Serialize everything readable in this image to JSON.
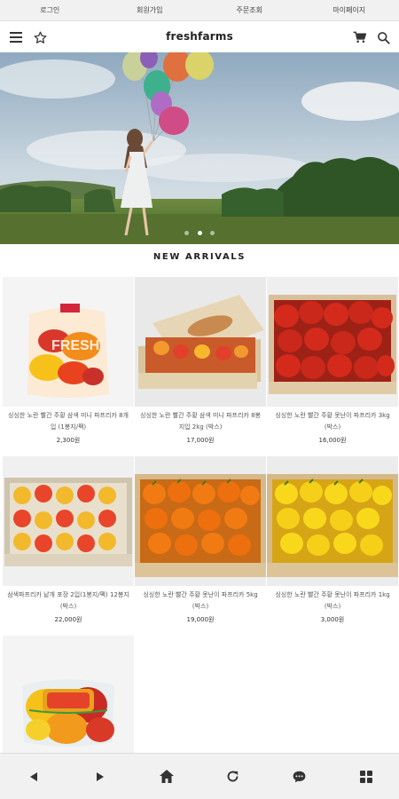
{
  "top_nav": {
    "login": "로그인",
    "signup": "회원가입",
    "order_lookup": "주문조회",
    "mypage": "마이페이지"
  },
  "header": {
    "logo": "freshfarms",
    "menu_icon": "menu-icon",
    "star_icon": "star-icon",
    "cart_icon": "cart-icon",
    "search_icon": "search-icon"
  },
  "hero": {
    "slide_count": 3,
    "active_slide": 2
  },
  "section": {
    "title": "NEW ARRIVALS"
  },
  "products": [
    {
      "name": "싱싱한 노란 빨간 주황 삼색 미니 파프리카 8개입 (1봉지/팩)",
      "price": "2,300원"
    },
    {
      "name": "싱싱한 노란 빨간 주황 삼색 미니 파프리카 8봉지입 2kg (박스)",
      "price": "17,000원"
    },
    {
      "name": "싱싱한 노란 빨간 주황 못난이 파프리카 3kg (박스)",
      "price": "16,000원"
    },
    {
      "name": "삼색파프리카 낱개 포장 2입(1봉지/팩) 12봉지 (박스)",
      "price": "22,000원"
    },
    {
      "name": "싱싱한 노란 빨간 주황 못난이 파프리카 5kg (박스)",
      "price": "19,000원"
    },
    {
      "name": "싱싱한 노란 빨간 주황 못난이 파프리카 1kg (박스)",
      "price": "3,000원"
    },
    {
      "name": "",
      "price": ""
    }
  ],
  "bottom_bar": [
    "back-icon",
    "forward-icon",
    "home-icon",
    "refresh-icon",
    "chat-icon",
    "apps-icon"
  ],
  "colors": {
    "top_bar_bg": "#f1f1f1",
    "bottom_bar_bg": "#f1f1f1",
    "text": "#222222",
    "price_text": "#333333"
  }
}
